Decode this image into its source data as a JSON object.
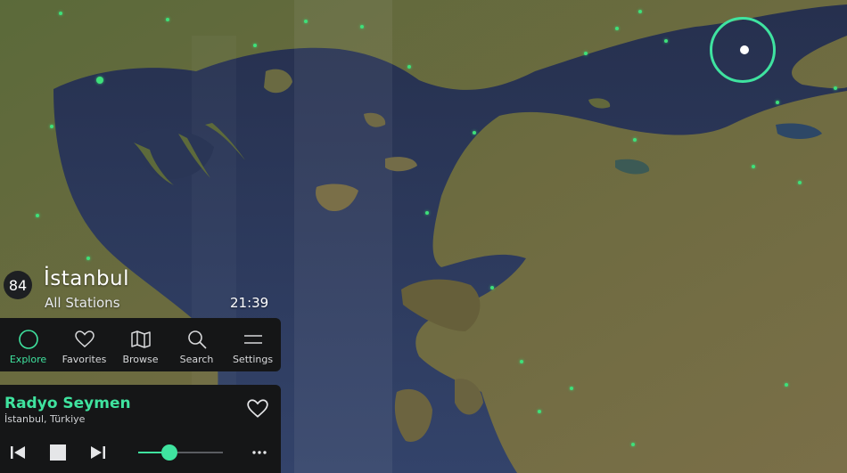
{
  "colors": {
    "accent": "#3fe39f",
    "panel": "#151617",
    "station_dot": "#3ee07a"
  },
  "city": {
    "count": "84",
    "name": "İstanbul",
    "subtitle": "All Stations",
    "time": "21:39"
  },
  "nav": [
    {
      "label": "Explore",
      "icon": "explore-circle-icon",
      "active": true
    },
    {
      "label": "Favorites",
      "icon": "heart-icon",
      "active": false
    },
    {
      "label": "Browse",
      "icon": "map-icon",
      "active": false
    },
    {
      "label": "Search",
      "icon": "search-icon",
      "active": false
    },
    {
      "label": "Settings",
      "icon": "menu-lines-icon",
      "active": false
    }
  ],
  "player": {
    "station": "Radyo Seymen",
    "location": "İstanbul, Türkiye",
    "favorite_icon": "heart-outline-icon",
    "controls": [
      "previous-icon",
      "stop-icon",
      "next-icon"
    ],
    "volume_fraction": 0.37,
    "more_icon": "more-dots-icon"
  }
}
